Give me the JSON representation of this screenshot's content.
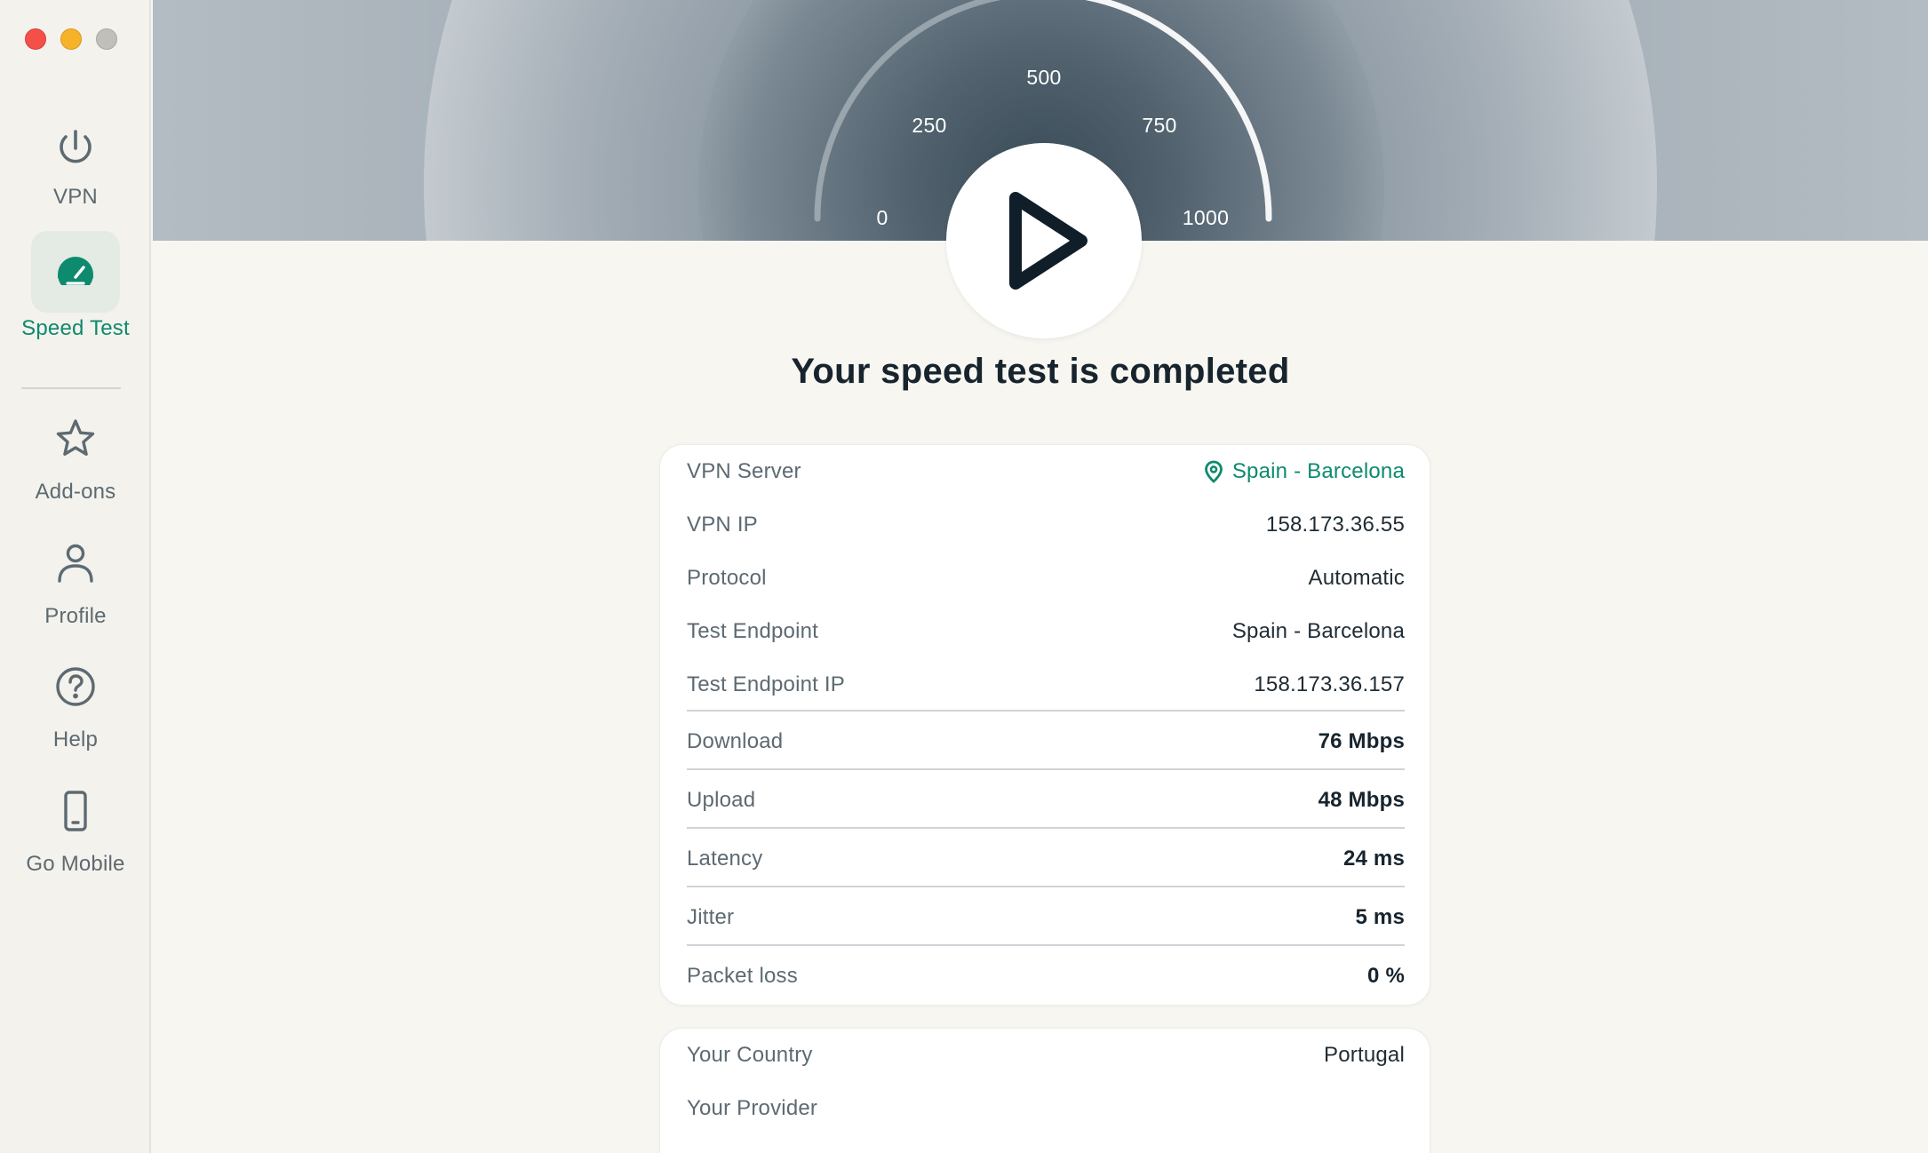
{
  "window": {
    "controls": [
      "close",
      "minimize",
      "zoom"
    ]
  },
  "sidebar": {
    "items": [
      {
        "label": "VPN",
        "icon": "power-icon",
        "active": false
      },
      {
        "label": "Speed Test",
        "icon": "speedometer-icon",
        "active": true
      },
      {
        "label": "Add-ons",
        "icon": "star-icon",
        "active": false
      },
      {
        "label": "Profile",
        "icon": "person-icon",
        "active": false
      },
      {
        "label": "Help",
        "icon": "question-circle-icon",
        "active": false
      },
      {
        "label": "Go Mobile",
        "icon": "phone-icon",
        "active": false
      }
    ]
  },
  "gauge": {
    "ticks": [
      "0",
      "250",
      "500",
      "750",
      "1000"
    ],
    "play_icon": "play-icon"
  },
  "status": {
    "title": "Your speed test is completed"
  },
  "results": {
    "rows": [
      {
        "label": "VPN Server",
        "value": "Spain - Barcelona",
        "style": "link",
        "icon": "location-pin-icon"
      },
      {
        "label": "VPN IP",
        "value": "158.173.36.55",
        "style": "plain"
      },
      {
        "label": "Protocol",
        "value": "Automatic",
        "style": "plain"
      },
      {
        "label": "Test Endpoint",
        "value": "Spain - Barcelona",
        "style": "plain"
      },
      {
        "label": "Test Endpoint IP",
        "value": "158.173.36.157",
        "style": "plain"
      },
      {
        "label": "Download",
        "value": "76 Mbps",
        "style": "bold"
      },
      {
        "label": "Upload",
        "value": "48 Mbps",
        "style": "bold"
      },
      {
        "label": "Latency",
        "value": "24 ms",
        "style": "bold"
      },
      {
        "label": "Jitter",
        "value": "5 ms",
        "style": "bold"
      },
      {
        "label": "Packet loss",
        "value": "0 %",
        "style": "bold"
      }
    ]
  },
  "local": {
    "rows": [
      {
        "label": "Your Country",
        "value": "Portugal"
      },
      {
        "label": "Your Provider",
        "value": ""
      }
    ]
  },
  "colors": {
    "accent": "#0e8a6e",
    "text_dark": "#17242e",
    "text_muted": "#5d6a72",
    "background": "#f7f6f1"
  }
}
